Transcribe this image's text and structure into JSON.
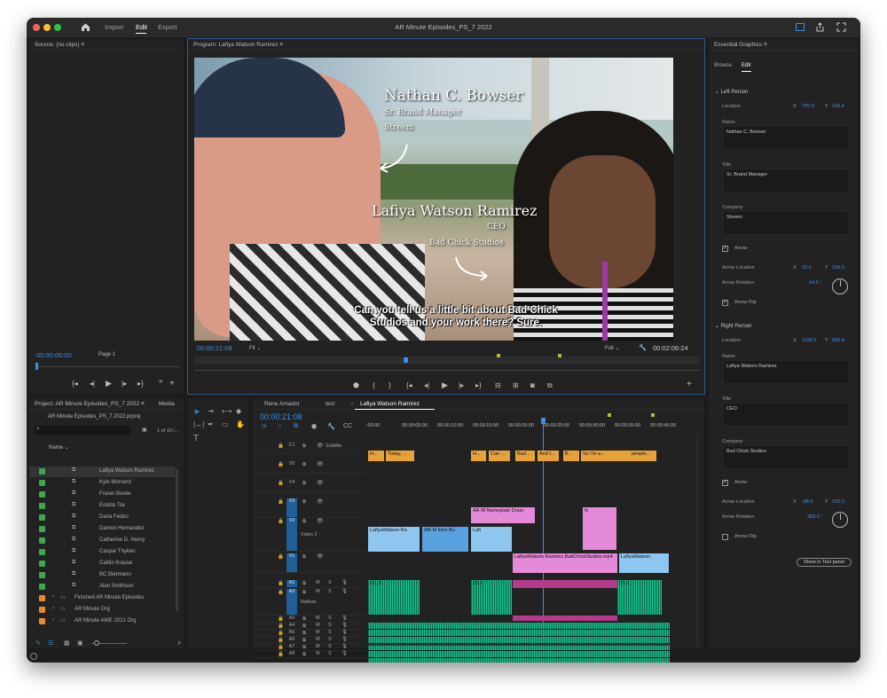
{
  "titlebar": {
    "title": "AR Minute Episodes_PS_7 2022",
    "tabs": [
      "Import",
      "Edit",
      "Export"
    ],
    "active_tab": "Edit"
  },
  "source": {
    "title": "Source: (no clips)",
    "timecode": "00:00:00:00",
    "page": "Page 1"
  },
  "program": {
    "title": "Program: Lafiya Watson Ramirez",
    "timecode": "00:00:21:08",
    "fit": "Fit",
    "quality": "Full",
    "duration": "00:02:06:24",
    "overlay": {
      "left_name": "Nathan C. Bowser",
      "left_title": "Sr. Brand Manager",
      "left_company": "Streem",
      "right_name": "Lafiya Watson Ramirez",
      "right_title": "CEO",
      "right_company": "Bad Chick Studios",
      "caption": "Can you tell us a little bit about Bad Chick Studios and your work there? Sure."
    }
  },
  "project": {
    "title": "Project: AR Minute Episodes_PS_7 2022",
    "tab2": "Media",
    "file": "AR Minute Episodes_PS_7 2022.prproj",
    "count": "1 of 19 i...",
    "col_name": "Name",
    "items": [
      "Lafiya Watson Ramirez",
      "Kyle Morrand",
      "Fraser Bowie",
      "Estella Tse",
      "Daria Fedko",
      "Damon Hernandez",
      "Catherine D. Henry",
      "Caspar Thykier",
      "Caitlin Krause",
      "BC Biermann",
      "Alan Smithson"
    ],
    "folders": [
      "Finished AR Minute Episodes",
      "AR Minute Org",
      "AR Minute AWE 2021 Org"
    ]
  },
  "timeline": {
    "tabs": [
      "Rene Amador",
      "test",
      "Lafiya Watson Ramirez"
    ],
    "timecode": "00:00:21:08",
    "ruler": [
      ":00:00",
      "00:00:05:00",
      "00:00:10:00",
      "00:00:15:00",
      "00:00:20:00",
      "00:00:25:00",
      "00:00:30:00",
      "00:00:35:00",
      "00:00:40:00"
    ],
    "tracks": {
      "c1": "C1",
      "sub": "Subtitle",
      "v5": "V5",
      "v4": "V4",
      "v3": "V3",
      "v2": "V2",
      "v2name": "Video 2",
      "v1": "V1",
      "a1": "A1",
      "a2": "A2",
      "a2name": "Nathan",
      "a3": "A3",
      "a4": "A4",
      "a5": "A5",
      "a6": "A6",
      "a7": "A7",
      "a8": "A8",
      "m": "M",
      "s": "S"
    },
    "captions": [
      "H...",
      "Today, ...",
      "H...",
      "Can ...",
      "Bad...",
      "And I...",
      "B...",
      "So I'm a...",
      "people..."
    ],
    "clips": {
      "nameplate": "AR-M Nameplate Draw-",
      "v2a": "LafiyaWatson.Ra",
      "v2b": "AR-M Intro Bu",
      "v2c": "Lafi",
      "v1a": "LafiyaWatson.Ramirez.BadChickStudios.mp4",
      "v1b": "LafiyaWatson."
    },
    "audio_labels": {
      "a": "Ch. 1",
      "b": "Ch.1",
      "fx": "fx"
    }
  },
  "eg": {
    "title": "Essential Graphics",
    "tabs": [
      "Browse",
      "Edit"
    ],
    "active_tab": "Edit",
    "left": {
      "header": "Left Person",
      "location_label": "Location",
      "x_label": "X",
      "loc_x": "700.0",
      "y_label": "Y",
      "loc_y": "108.4",
      "name_label": "Name",
      "name": "Nathan C. Bowser",
      "title_label": "Title",
      "title": "Sr. Brand Manager",
      "company_label": "Company",
      "company": "Streem",
      "arrow": "Arrow",
      "arrow_loc_label": "Arrow Location",
      "arrow_x": "22.0",
      "arrow_y": "159.0",
      "rotation_label": "Arrow Rotation",
      "rotation": "-14.5 °",
      "flip": "Arrow Flip"
    },
    "right": {
      "header": "Right Person",
      "location_label": "Location",
      "loc_x": "1195.0",
      "loc_y": "588.4",
      "name_label": "Name",
      "name": "Lafiya Watson Ramirez",
      "title_label": "Title",
      "title": "CEO",
      "company_label": "Company",
      "company": "Bad Chick Studios",
      "arrow": "Arrow",
      "arrow_loc_label": "Arrow Location",
      "arrow_x": "-88.9",
      "arrow_y": "150.0",
      "rotation_label": "Arrow Rotation",
      "rotation": "358.0 °",
      "flip": "Arrow Flip"
    },
    "show_btn": "Show in Text panel"
  },
  "colors": {
    "accent": "#3a8fe6",
    "caption_clip": "#e8a23a",
    "graphic_clip": "#e58ad8",
    "video_clip": "#8fc6ef",
    "audio": "#18c48c",
    "bin_green": "#3ea64e",
    "bin_orange": "#e8892e"
  }
}
